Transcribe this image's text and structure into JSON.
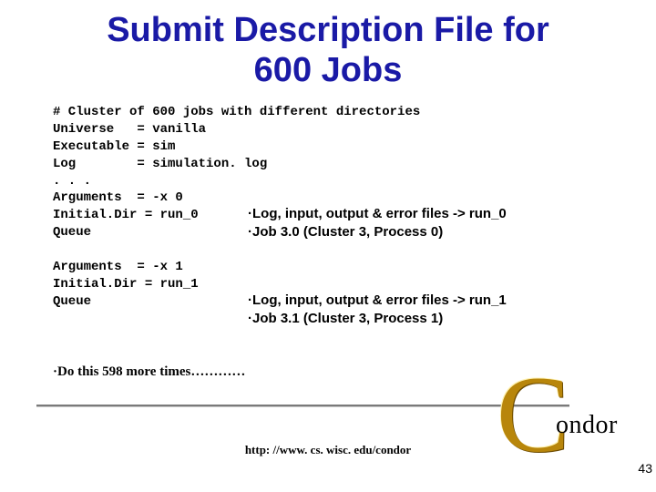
{
  "title": "Submit Description File for\n600 Jobs",
  "code": "# Cluster of 600 jobs with different directories\nUniverse   = vanilla\nExecutable = sim\nLog        = simulation. log\n. . .\nArguments  = -x 0\nInitial.Dir = run_0\nQueue\n\nArguments  = -x 1\nInitial.Dir = run_1\nQueue",
  "note1_line1": "·Log, input, output & error files -> run_0",
  "note1_line2": "·Job 3.0 (Cluster 3, Process 0)",
  "note2_line1": "·Log, input, output & error files -> run_1",
  "note2_line2": "·Job 3.1 (Cluster 3, Process 1)",
  "final": "·Do this 598 more times…………",
  "url": "http: //www. cs. wisc. edu/condor",
  "pagenum": "43",
  "logo_c": "C",
  "logo_rest": "ondor"
}
